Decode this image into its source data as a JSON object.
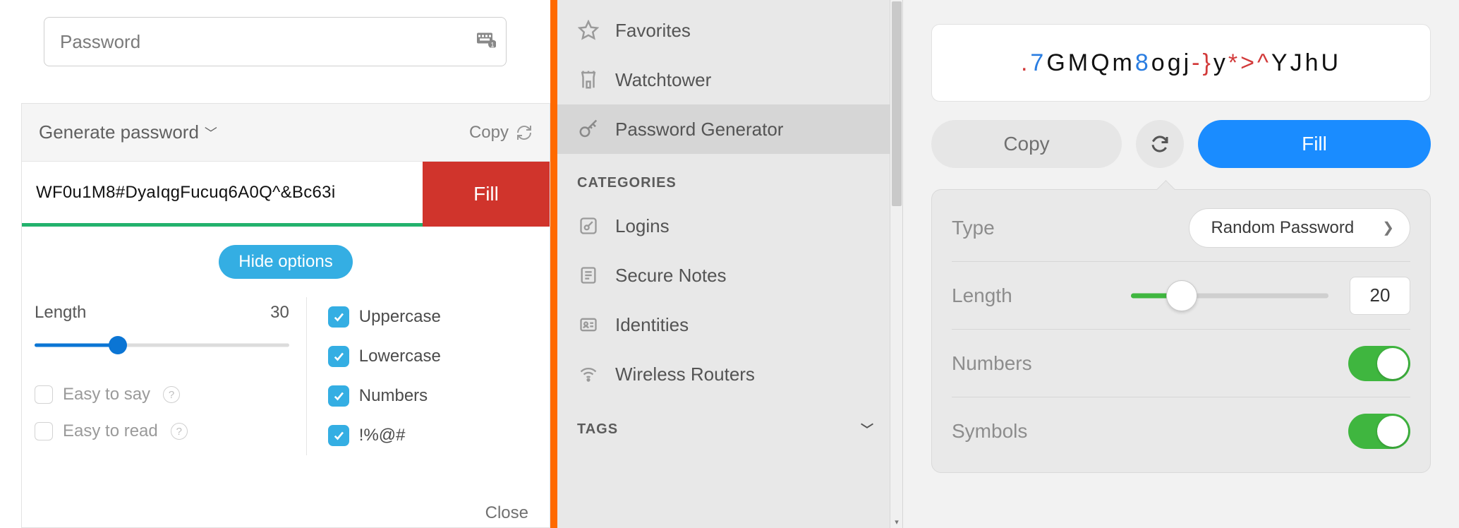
{
  "left": {
    "password_placeholder": "Password",
    "header_title": "Generate password",
    "copy_label": "Copy",
    "generated_value": "WF0u1M8#DyaIqgFucuq6A0Q^&Bc63i",
    "fill_label": "Fill",
    "hide_options_label": "Hide options",
    "length_label": "Length",
    "length_value": "30",
    "easy_say_label": "Easy to say",
    "easy_read_label": "Easy to read",
    "uppercase_label": "Uppercase",
    "lowercase_label": "Lowercase",
    "numbers_label": "Numbers",
    "symbols_label": "!%@#",
    "close_label": "Close"
  },
  "mid": {
    "nav": [
      {
        "label": "Favorites"
      },
      {
        "label": "Watchtower"
      },
      {
        "label": "Password Generator"
      }
    ],
    "categories_header": "CATEGORIES",
    "categories": [
      {
        "label": "Logins"
      },
      {
        "label": "Secure Notes"
      },
      {
        "label": "Identities"
      },
      {
        "label": "Wireless Routers"
      }
    ],
    "tags_header": "TAGS"
  },
  "right": {
    "pw_segments": [
      {
        "t": ".",
        "c": "s"
      },
      {
        "t": "7",
        "c": "d"
      },
      {
        "t": "GMQm",
        "c": "p"
      },
      {
        "t": "8",
        "c": "d"
      },
      {
        "t": "ogj",
        "c": "p"
      },
      {
        "t": "-}",
        "c": "s"
      },
      {
        "t": "y",
        "c": "p"
      },
      {
        "t": "*>^",
        "c": "s"
      },
      {
        "t": "YJhU",
        "c": "p"
      }
    ],
    "copy_label": "Copy",
    "fill_label": "Fill",
    "type_label": "Type",
    "type_value": "Random Password",
    "length_label": "Length",
    "length_value": "20",
    "numbers_label": "Numbers",
    "symbols_label": "Symbols"
  }
}
